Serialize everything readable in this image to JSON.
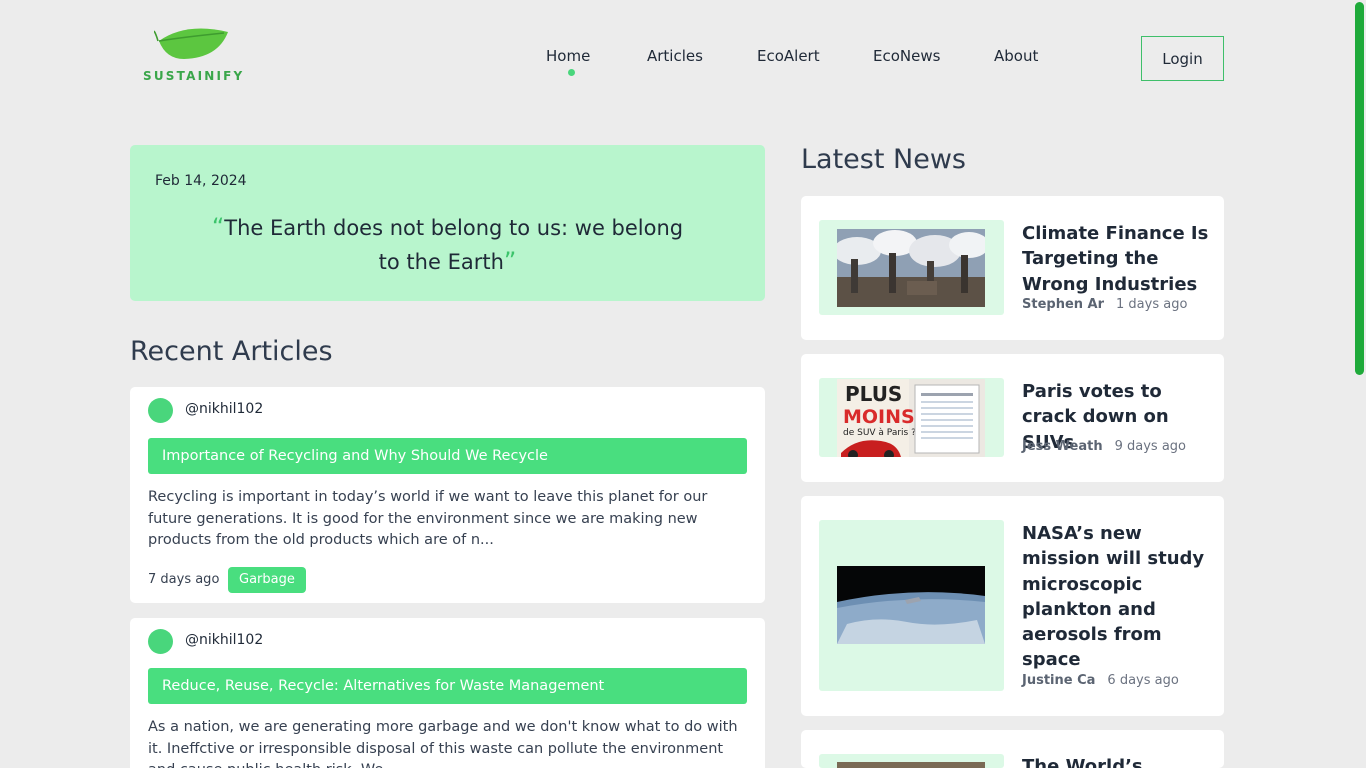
{
  "brand": {
    "name": "SUSTAINIFY"
  },
  "nav": {
    "items": [
      {
        "label": "Home",
        "active": true
      },
      {
        "label": "Articles"
      },
      {
        "label": "EcoAlert"
      },
      {
        "label": "EcoNews"
      },
      {
        "label": "About"
      }
    ],
    "login_label": "Login"
  },
  "quote": {
    "date": "Feb 14, 2024",
    "text": "The Earth does not belong to us: we belong to the Earth",
    "open_mark": "“",
    "close_mark": "”"
  },
  "recent_articles": {
    "heading": "Recent Articles",
    "items": [
      {
        "author": "@nikhil102",
        "title": "Importance of Recycling and Why Should We Recycle",
        "excerpt": "Recycling is important in today’s world if we want to leave this planet for our future generations. It is good for the environment since we are making new products from the old products which are of n...",
        "time": "7 days ago",
        "tag": "Garbage"
      },
      {
        "author": "@nikhil102",
        "title": "Reduce, Reuse, Recycle: Alternatives for Waste Management",
        "excerpt": "As a nation, we are generating more garbage and we don't know what to do with it. Ineffctive or irresponsible disposal of this waste can pollute the environment and cause public health risk. We..."
      }
    ]
  },
  "latest_news": {
    "heading": "Latest News",
    "items": [
      {
        "title": "Climate Finance Is Targeting the Wrong Industries",
        "author": "Stephen Ar",
        "time": "1 days ago",
        "image": "smokestacks-photo"
      },
      {
        "title": "Paris votes to crack down on SUVs",
        "author": "Jess Weath",
        "time": "9 days ago",
        "image": "plus-ou-moins-poster-photo"
      },
      {
        "title": "NASA’s new mission will study microscopic plankton and aerosols from space",
        "author": "Justine Ca",
        "time": "6 days ago",
        "image": "earth-from-orbit-photo"
      },
      {
        "title": "The World’s"
      }
    ]
  },
  "colors": {
    "accent": "#49de7f",
    "quote_bg": "#b8f5cd",
    "logo_green": "#3aa64a",
    "scrollbar": "#1faa3a"
  }
}
